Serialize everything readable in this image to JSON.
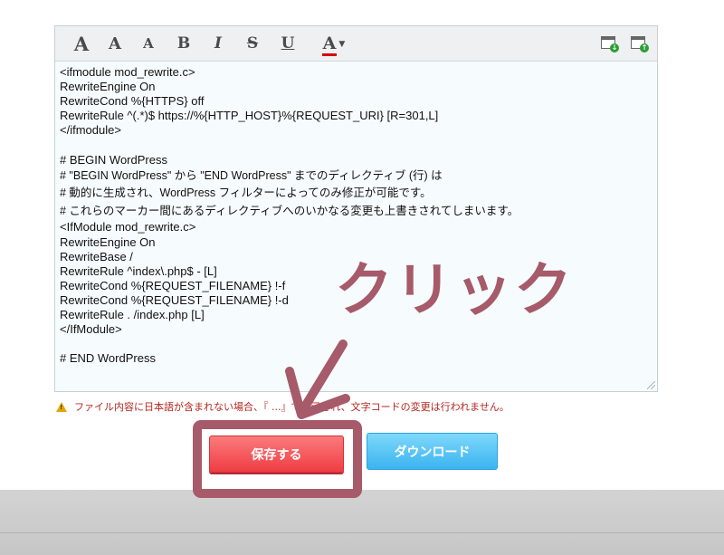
{
  "toolbar": {
    "heading1": "A",
    "heading2": "A",
    "heading3": "A",
    "bold": "B",
    "italic": "I",
    "strike": "S",
    "underline": "U",
    "font_color": "A",
    "font_color_accent": "#d40000",
    "download_icon": "download-file-icon",
    "upload_icon": "upload-file-icon"
  },
  "editor": {
    "lines": [
      "<ifmodule mod_rewrite.c>",
      "RewriteEngine On",
      "RewriteCond %{HTTPS} off",
      "RewriteRule ^(.*)$ https://%{HTTP_HOST}%{REQUEST_URI} [R=301,L]",
      "</ifmodule>",
      "",
      "# BEGIN WordPress",
      "# \"BEGIN WordPress\" から \"END WordPress\" までのディレクティブ (行) は",
      "# 動的に生成され、WordPress フィルターによってのみ修正が可能です。",
      "# これらのマーカー間にあるディレクティブへのいかなる変更も上書きされてしまいます。",
      "<IfModule mod_rewrite.c>",
      "RewriteEngine On",
      "RewriteBase /",
      "RewriteRule ^index\\.php$ - [L]",
      "RewriteCond %{REQUEST_FILENAME} !-f",
      "RewriteCond %{REQUEST_FILENAME} !-d",
      "RewriteRule . /index.php [L]",
      "</IfModule>",
      "",
      "# END WordPress"
    ]
  },
  "warning": {
    "text": "ファイル内容に日本語が含まれない場合、『 ...』で表示され、文字コードの変更は行われません。",
    "color": "#b3261e"
  },
  "buttons": {
    "save_label": "保存する",
    "download_label": "ダウンロード",
    "save_color": "#ef3d44",
    "download_color": "#3bb4ef"
  },
  "annotation": {
    "text": "クリック",
    "color": "#a65a6a"
  }
}
